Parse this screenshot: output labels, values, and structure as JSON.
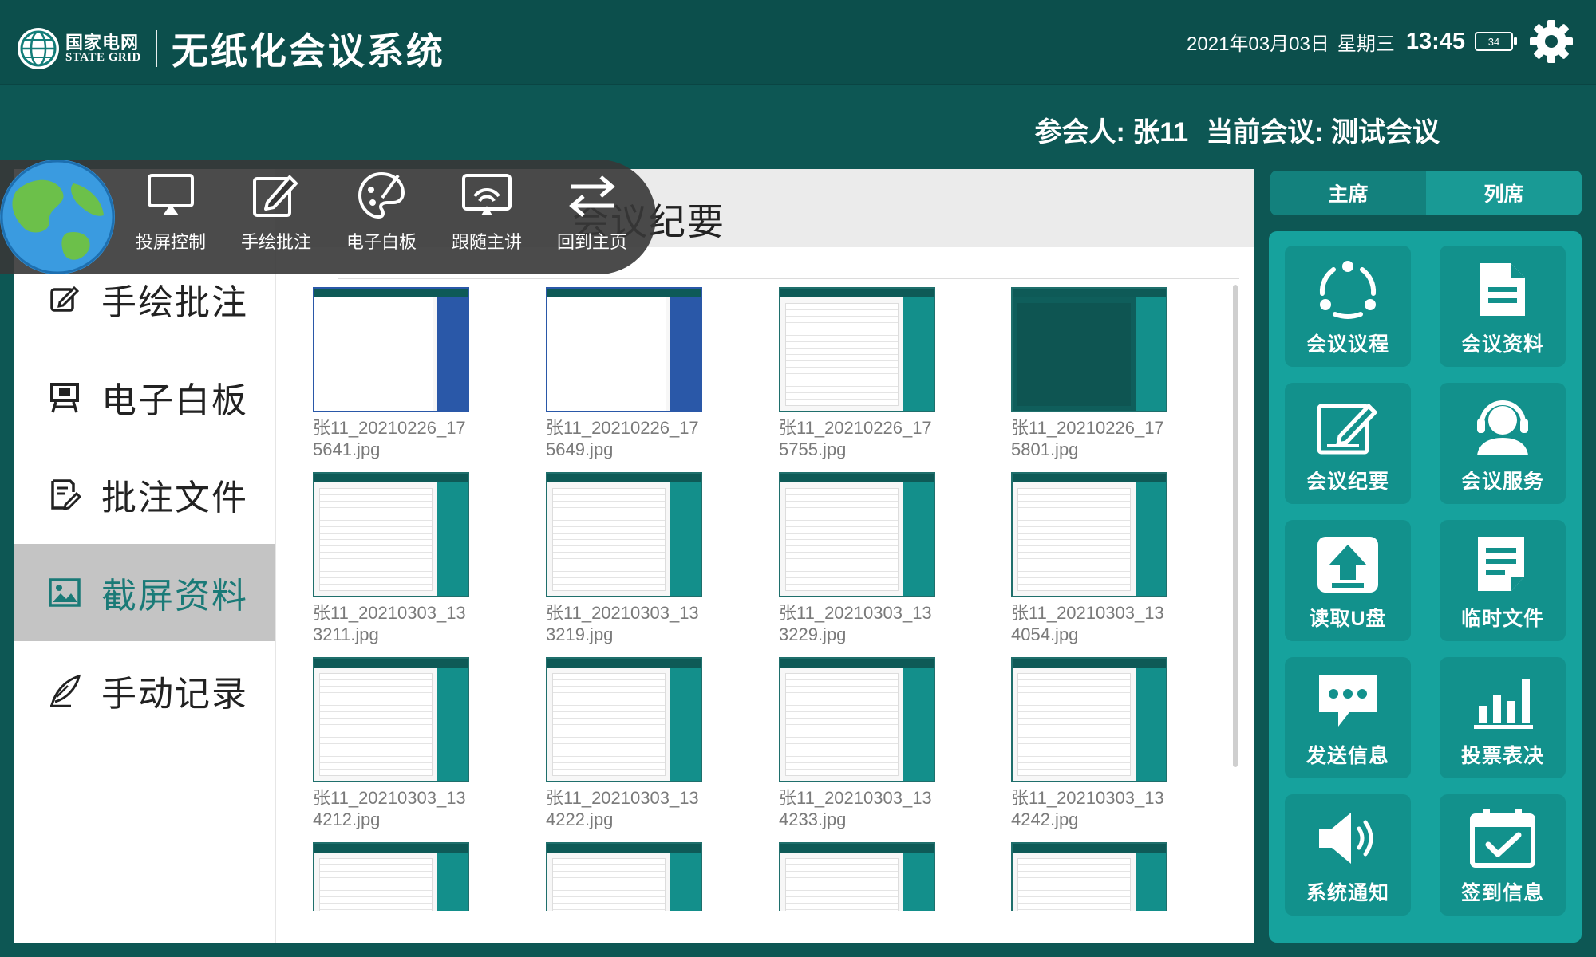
{
  "header": {
    "logo_cn": "国家电网",
    "logo_en": "STATE GRID",
    "app_title": "无纸化会议系统",
    "date": "2021年03月03日",
    "weekday": "星期三",
    "time": "13:45",
    "battery": "34"
  },
  "meeting": {
    "attendee_label": "参会人: 张11",
    "meeting_label": "当前会议: 测试会议"
  },
  "floating_toolbar": {
    "items": [
      {
        "label": "投屏控制",
        "icon": "screen-cast-icon"
      },
      {
        "label": "手绘批注",
        "icon": "pen-edit-icon"
      },
      {
        "label": "电子白板",
        "icon": "palette-icon"
      },
      {
        "label": "跟随主讲",
        "icon": "follow-broadcast-icon"
      },
      {
        "label": "回到主页",
        "icon": "return-home-icon"
      }
    ]
  },
  "content_title": "会议纪要",
  "sidebar": {
    "items": [
      {
        "label": "手绘批注",
        "icon": "pen-square-icon",
        "active": false
      },
      {
        "label": "电子白板",
        "icon": "whiteboard-icon",
        "active": false
      },
      {
        "label": "批注文件",
        "icon": "annotate-file-icon",
        "active": false
      },
      {
        "label": "截屏资料",
        "icon": "image-icon",
        "active": true
      },
      {
        "label": "手动记录",
        "icon": "quill-icon",
        "active": false
      }
    ]
  },
  "screenshots": [
    {
      "file": "张11_20210226_175641.jpg",
      "style": "blue"
    },
    {
      "file": "张11_20210226_175649.jpg",
      "style": "blue"
    },
    {
      "file": "张11_20210226_175755.jpg",
      "style": "teal"
    },
    {
      "file": "张11_20210226_175801.jpg",
      "style": "dark"
    },
    {
      "file": "张11_20210303_133211.jpg",
      "style": "teal"
    },
    {
      "file": "张11_20210303_133219.jpg",
      "style": "teal"
    },
    {
      "file": "张11_20210303_133229.jpg",
      "style": "teal"
    },
    {
      "file": "张11_20210303_134054.jpg",
      "style": "teal"
    },
    {
      "file": "张11_20210303_134212.jpg",
      "style": "teal"
    },
    {
      "file": "张11_20210303_134222.jpg",
      "style": "teal"
    },
    {
      "file": "张11_20210303_134233.jpg",
      "style": "teal"
    },
    {
      "file": "张11_20210303_134242.jpg",
      "style": "teal"
    },
    {
      "file": "",
      "style": "teal"
    },
    {
      "file": "",
      "style": "teal"
    },
    {
      "file": "",
      "style": "teal"
    },
    {
      "file": "",
      "style": "teal"
    }
  ],
  "right_tabs": [
    {
      "label": "主席",
      "active": true
    },
    {
      "label": "列席",
      "active": false
    }
  ],
  "right_tiles": [
    {
      "label": "会议议程",
      "icon": "agenda-icon"
    },
    {
      "label": "会议资料",
      "icon": "document-icon"
    },
    {
      "label": "会议纪要",
      "icon": "minutes-edit-icon"
    },
    {
      "label": "会议服务",
      "icon": "headset-service-icon"
    },
    {
      "label": "读取U盘",
      "icon": "upload-usb-icon"
    },
    {
      "label": "临时文件",
      "icon": "temp-file-icon"
    },
    {
      "label": "发送信息",
      "icon": "chat-bubble-icon"
    },
    {
      "label": "投票表决",
      "icon": "bar-chart-icon"
    },
    {
      "label": "系统通知",
      "icon": "speaker-icon"
    },
    {
      "label": "签到信息",
      "icon": "calendar-check-icon"
    }
  ],
  "colors": {
    "header_bg": "#0c4f4c",
    "page_bg": "#0d5754",
    "accent": "#16a29d",
    "active_text": "#1a7a77"
  }
}
